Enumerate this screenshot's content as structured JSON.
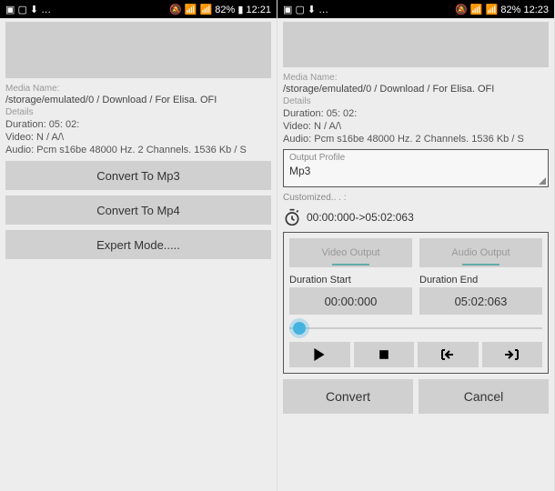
{
  "status": {
    "icons_left": "▣ ▢ ⬇ …",
    "icons_right1": "🔕 📶 📶 82% ▮ 12:21",
    "icons_right2": "🔕 📶 📶 82% 12:23"
  },
  "left": {
    "media_name_label": "Media Name:",
    "media_path": "/storage/emulated/0 / Download / For Elisa. OFI",
    "details_label": "Details",
    "duration": "Duration: 05: 02:",
    "video": "Video: N / A/\\",
    "audio": "Audio: Pcm  s16be 48000 Hz. 2 Channels. 1536 Kb / S",
    "btn_mp3": "Convert To Mp3",
    "btn_mp4": "Convert To Mp4",
    "btn_expert": "Expert Mode....."
  },
  "right": {
    "media_name_label": "Media Name:",
    "media_path": "/storage/emulated/0 / Download / For Elisa. OFI",
    "details_label": "Details",
    "duration": "Duration: 05: 02:",
    "video": "Video: N / A/\\",
    "audio": "Audio: Pcm  s16be 48000 Hz. 2 Channels. 1536 Kb / S",
    "output_profile_label": "Output Profile",
    "output_profile_value": "Mp3",
    "customized_label": "Customized.. . :",
    "time_range": "00:00:000->05:02:063",
    "video_output": "Video Output",
    "audio_output": "Audio Output",
    "dur_start_label": "Duration Start",
    "dur_start_value": "00:00:000",
    "dur_end_label": "Duration End",
    "dur_end_value": "05:02:063",
    "convert": "Convert",
    "cancel": "Cancel"
  }
}
